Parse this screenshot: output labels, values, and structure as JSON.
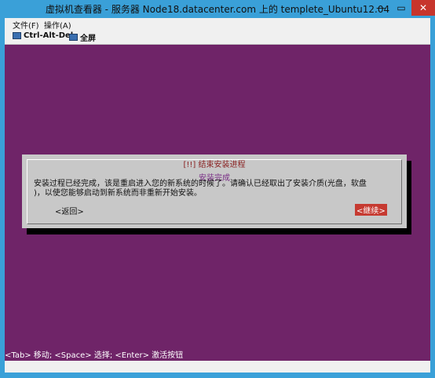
{
  "window": {
    "title": "虚拟机查看器 - 服务器 Node18.datacenter.com 上的 templete_Ubuntu12.04",
    "controls": {
      "minimize": "—",
      "maximize": "▭",
      "close": "✕"
    }
  },
  "menu": {
    "file": "文件(F)",
    "actions": "操作(A)"
  },
  "toolbar": {
    "ctrl_alt_del": "Ctrl-Alt-Del",
    "fullscreen": "全屏"
  },
  "dialog": {
    "title": "[!!] 结束安装进程",
    "heading": "安装完成",
    "body_line1": "安装过程已经完成，该是重启进入您的新系统的时候了。请确认已经取出了安装介质(光盘，软盘",
    "body_line2": ")，以使您能够启动到新系统而非重新开始安装。",
    "back_button": "<返回>",
    "continue_button": "<继续>"
  },
  "status": {
    "hint": "<Tab> 移动; <Space> 选择; <Enter> 激活按钮"
  }
}
